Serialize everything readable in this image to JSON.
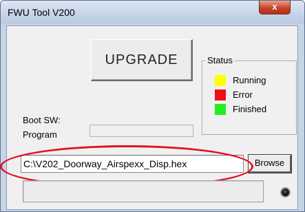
{
  "window": {
    "title": "FWU Tool V200",
    "close_label": "x"
  },
  "main": {
    "upgrade_label": "UPGRADE",
    "boot_sw_label": "Boot SW:",
    "program_label": "Program",
    "file_path": "C:\\V202_Doorway_Airspexx_Disp.hex",
    "browse_label": "Browse"
  },
  "status": {
    "title": "Status",
    "items": [
      {
        "label": "Running",
        "color": "#ffff00"
      },
      {
        "label": "Error",
        "color": "#ee1111"
      },
      {
        "label": "Finished",
        "color": "#22ee22"
      }
    ]
  },
  "colors": {
    "highlight": "#e0121f",
    "indicator": "#000000"
  }
}
